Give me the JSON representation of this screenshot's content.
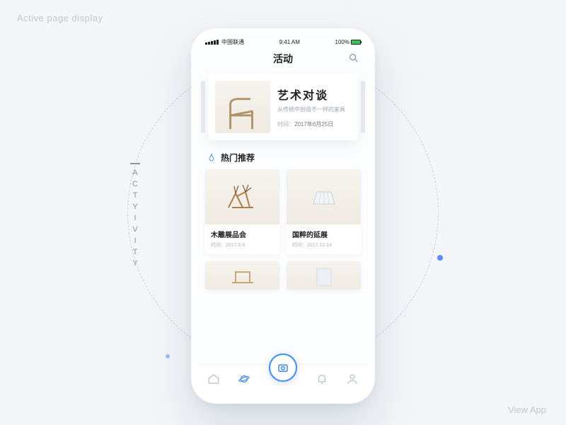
{
  "page_labels": {
    "top_left": "Active page display",
    "bottom_right": "View App",
    "vertical": "ACTYIVITY"
  },
  "statusbar": {
    "carrier": "中国联通",
    "time": "9:41 AM",
    "battery": "100%"
  },
  "navbar": {
    "title": "活动"
  },
  "hero": {
    "title": "艺术对谈",
    "subtitle": "从传统中创造不一样的家具",
    "date_label": "时间：",
    "date_value": "2017年6月25日"
  },
  "section": {
    "title": "热门推荐"
  },
  "cards": [
    {
      "title": "木雕展品会",
      "date_label": "时间：",
      "date_value": "2017.6.6"
    },
    {
      "title": "国粹的延展",
      "date_label": "时间：",
      "date_value": "2017.10.14"
    }
  ]
}
